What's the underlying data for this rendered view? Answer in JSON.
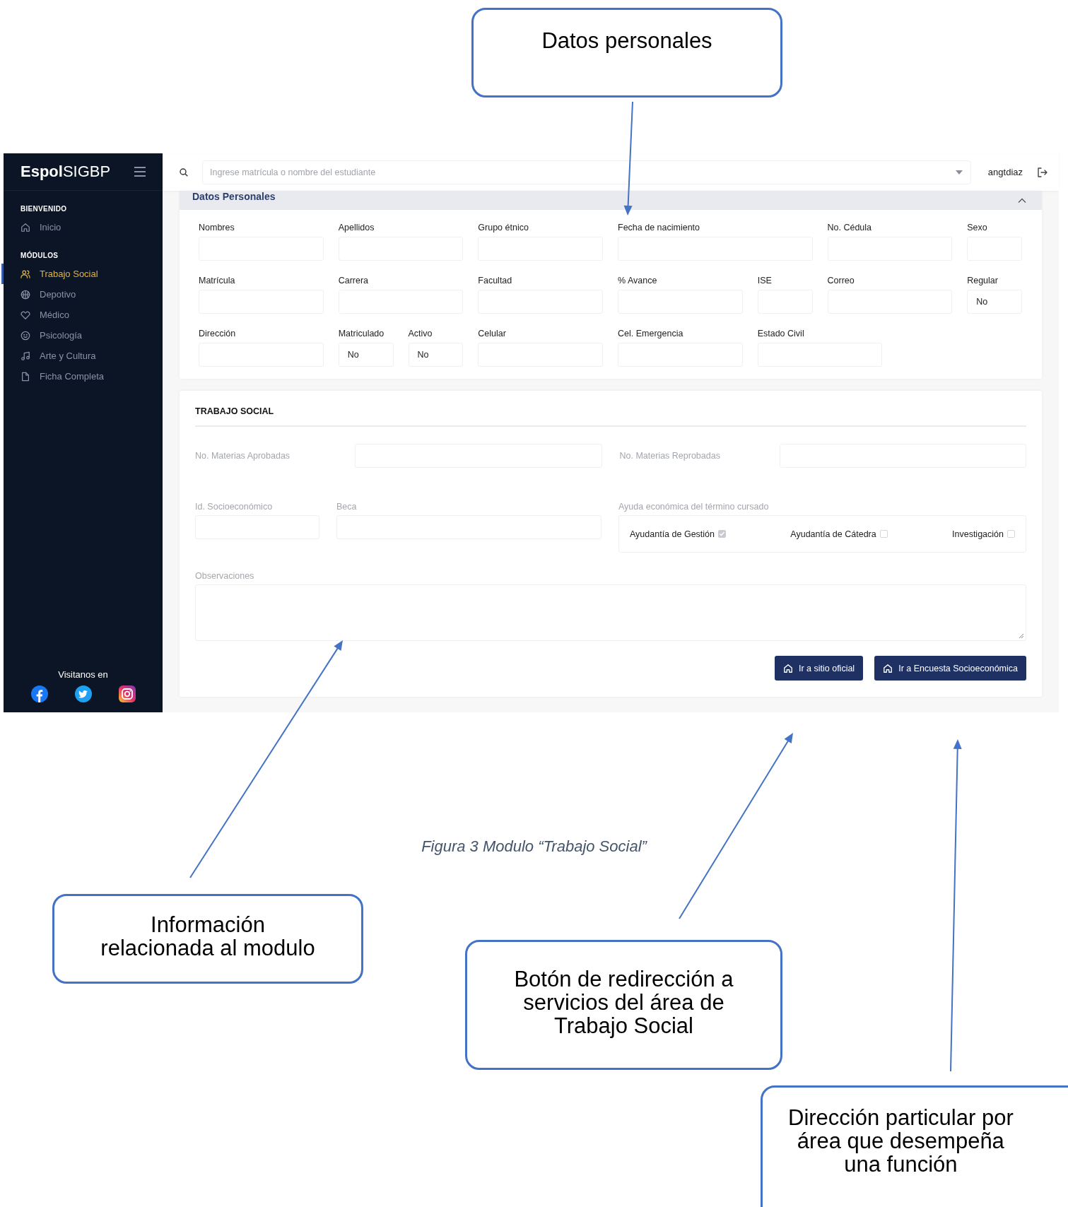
{
  "callouts": [
    {
      "text": "Datos personales"
    },
    {
      "text": "Información\nrelacionada al modulo"
    },
    {
      "text": "Botón de redirección a\nservicios del área de\nTrabajo Social"
    },
    {
      "text": "Dirección particular por\nárea que desempeña\nuna función"
    }
  ],
  "app": {
    "sidebar": {
      "logo_bold": "Espol",
      "logo_light": "SIGBP",
      "sections": [
        {
          "heading": "BIENVENIDO",
          "items": [
            {
              "label": "Inicio",
              "selected": false
            }
          ]
        },
        {
          "heading": "MÓDULOS",
          "items": [
            {
              "label": "Trabajo Social",
              "selected": true
            },
            {
              "label": "Depotivo",
              "selected": false
            },
            {
              "label": "Médico",
              "selected": false
            },
            {
              "label": "Psicología",
              "selected": false
            },
            {
              "label": "Arte y Cultura",
              "selected": false
            },
            {
              "label": "Ficha Completa",
              "selected": false
            }
          ]
        }
      ],
      "footer_label": "Visitanos en"
    },
    "topbar": {
      "search_placeholder": "Ingrese matrícula o nombre del estudiante",
      "username": "angtdiaz"
    },
    "personal": {
      "title": "Datos Personales",
      "fields": [
        {
          "label": "Nombres"
        },
        {
          "label": "Apellidos"
        },
        {
          "label": "Grupo étnico"
        },
        {
          "label": "Fecha de nacimiento"
        },
        {
          "label": "No. Cédula"
        },
        {
          "label": "Sexo"
        },
        {
          "label": "Matrícula"
        },
        {
          "label": "Carrera"
        },
        {
          "label": "Facultad"
        },
        {
          "label": "% Avance"
        },
        {
          "label": "ISE"
        },
        {
          "label": "Correo"
        },
        {
          "label": "Regular",
          "value": "No"
        },
        {
          "label": "Dirección"
        },
        {
          "label": "Matriculado",
          "value": "No"
        },
        {
          "label": "Activo",
          "value": "No"
        },
        {
          "label": "Celular"
        },
        {
          "label": "Cel. Emergencia"
        },
        {
          "label": "Estado Civil"
        }
      ]
    },
    "social_work": {
      "title": "TRABAJO SOCIAL",
      "subjects": [
        {
          "label": "No. Materias Aprobadas"
        },
        {
          "label": "No. Materias Reprobadas"
        }
      ],
      "id_label": "Id. Socioeconómico",
      "beca_label": "Beca",
      "aid": {
        "label": "Ayuda económica del término cursado",
        "options": [
          {
            "label": "Ayudantía de Gestión",
            "checked": true
          },
          {
            "label": "Ayudantía de Cátedra",
            "checked": false
          },
          {
            "label": "Investigación",
            "checked": false
          }
        ]
      },
      "observations_label": "Observaciones",
      "buttons": [
        "Ir a sitio oficial",
        "Ir a Encuesta Socioeconómica"
      ]
    }
  },
  "figure_caption": "Figura 3 Modulo “Trabajo Social”"
}
